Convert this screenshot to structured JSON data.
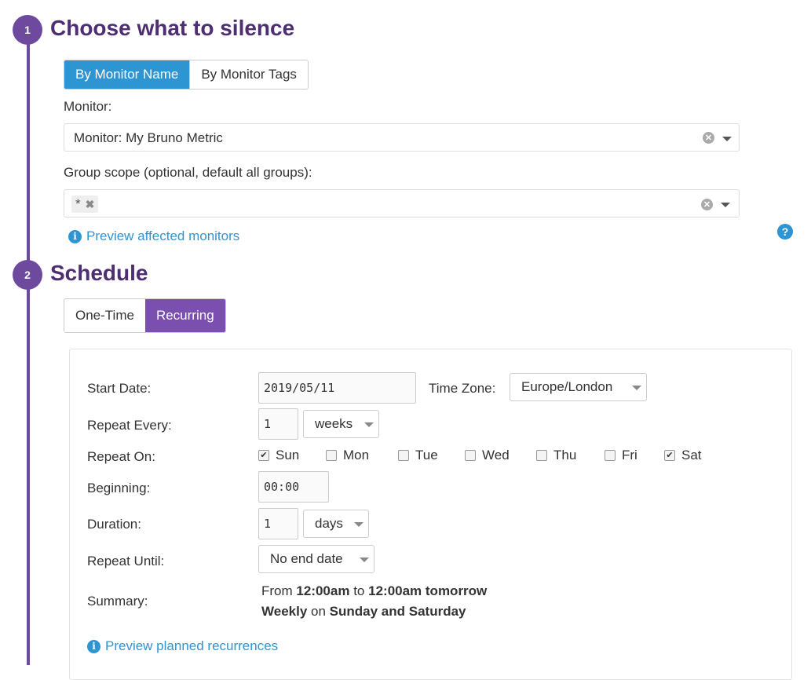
{
  "step1": {
    "number": "1",
    "title": "Choose what to silence",
    "tabs": {
      "by_name": "By Monitor Name",
      "by_tags": "By Monitor Tags"
    },
    "monitor_label": "Monitor:",
    "monitor_value": "Monitor: My Bruno Metric",
    "scope_label": "Group scope (optional, default all groups):",
    "scope_tag": "*",
    "preview_link": "Preview affected monitors"
  },
  "help_icon": "question-circle-icon",
  "step2": {
    "number": "2",
    "title": "Schedule",
    "tabs": {
      "one_time": "One-Time",
      "recurring": "Recurring"
    },
    "form": {
      "start_date_label": "Start Date:",
      "start_date_value": "2019/05/11",
      "timezone_label": "Time Zone:",
      "timezone_value": "Europe/London",
      "repeat_every_label": "Repeat Every:",
      "repeat_every_value": "1",
      "repeat_every_unit": "weeks",
      "repeat_on_label": "Repeat On:",
      "days": [
        {
          "label": "Sun",
          "checked": true
        },
        {
          "label": "Mon",
          "checked": false
        },
        {
          "label": "Tue",
          "checked": false
        },
        {
          "label": "Wed",
          "checked": false
        },
        {
          "label": "Thu",
          "checked": false
        },
        {
          "label": "Fri",
          "checked": false
        },
        {
          "label": "Sat",
          "checked": true
        }
      ],
      "beginning_label": "Beginning:",
      "beginning_value": "00:00",
      "duration_label": "Duration:",
      "duration_value": "1",
      "duration_unit": "days",
      "repeat_until_label": "Repeat Until:",
      "repeat_until_value": "No end date",
      "summary_label": "Summary:",
      "summary": {
        "from": "From",
        "start_time": "12:00am",
        "to": "to",
        "end_time": "12:00am tomorrow",
        "frequency": "Weekly",
        "on": "on",
        "days_text": "Sunday and Saturday"
      },
      "preview_link": "Preview planned recurrences"
    }
  },
  "colors": {
    "accent_purple": "#6e4a9e",
    "accent_blue": "#2e95d3"
  }
}
